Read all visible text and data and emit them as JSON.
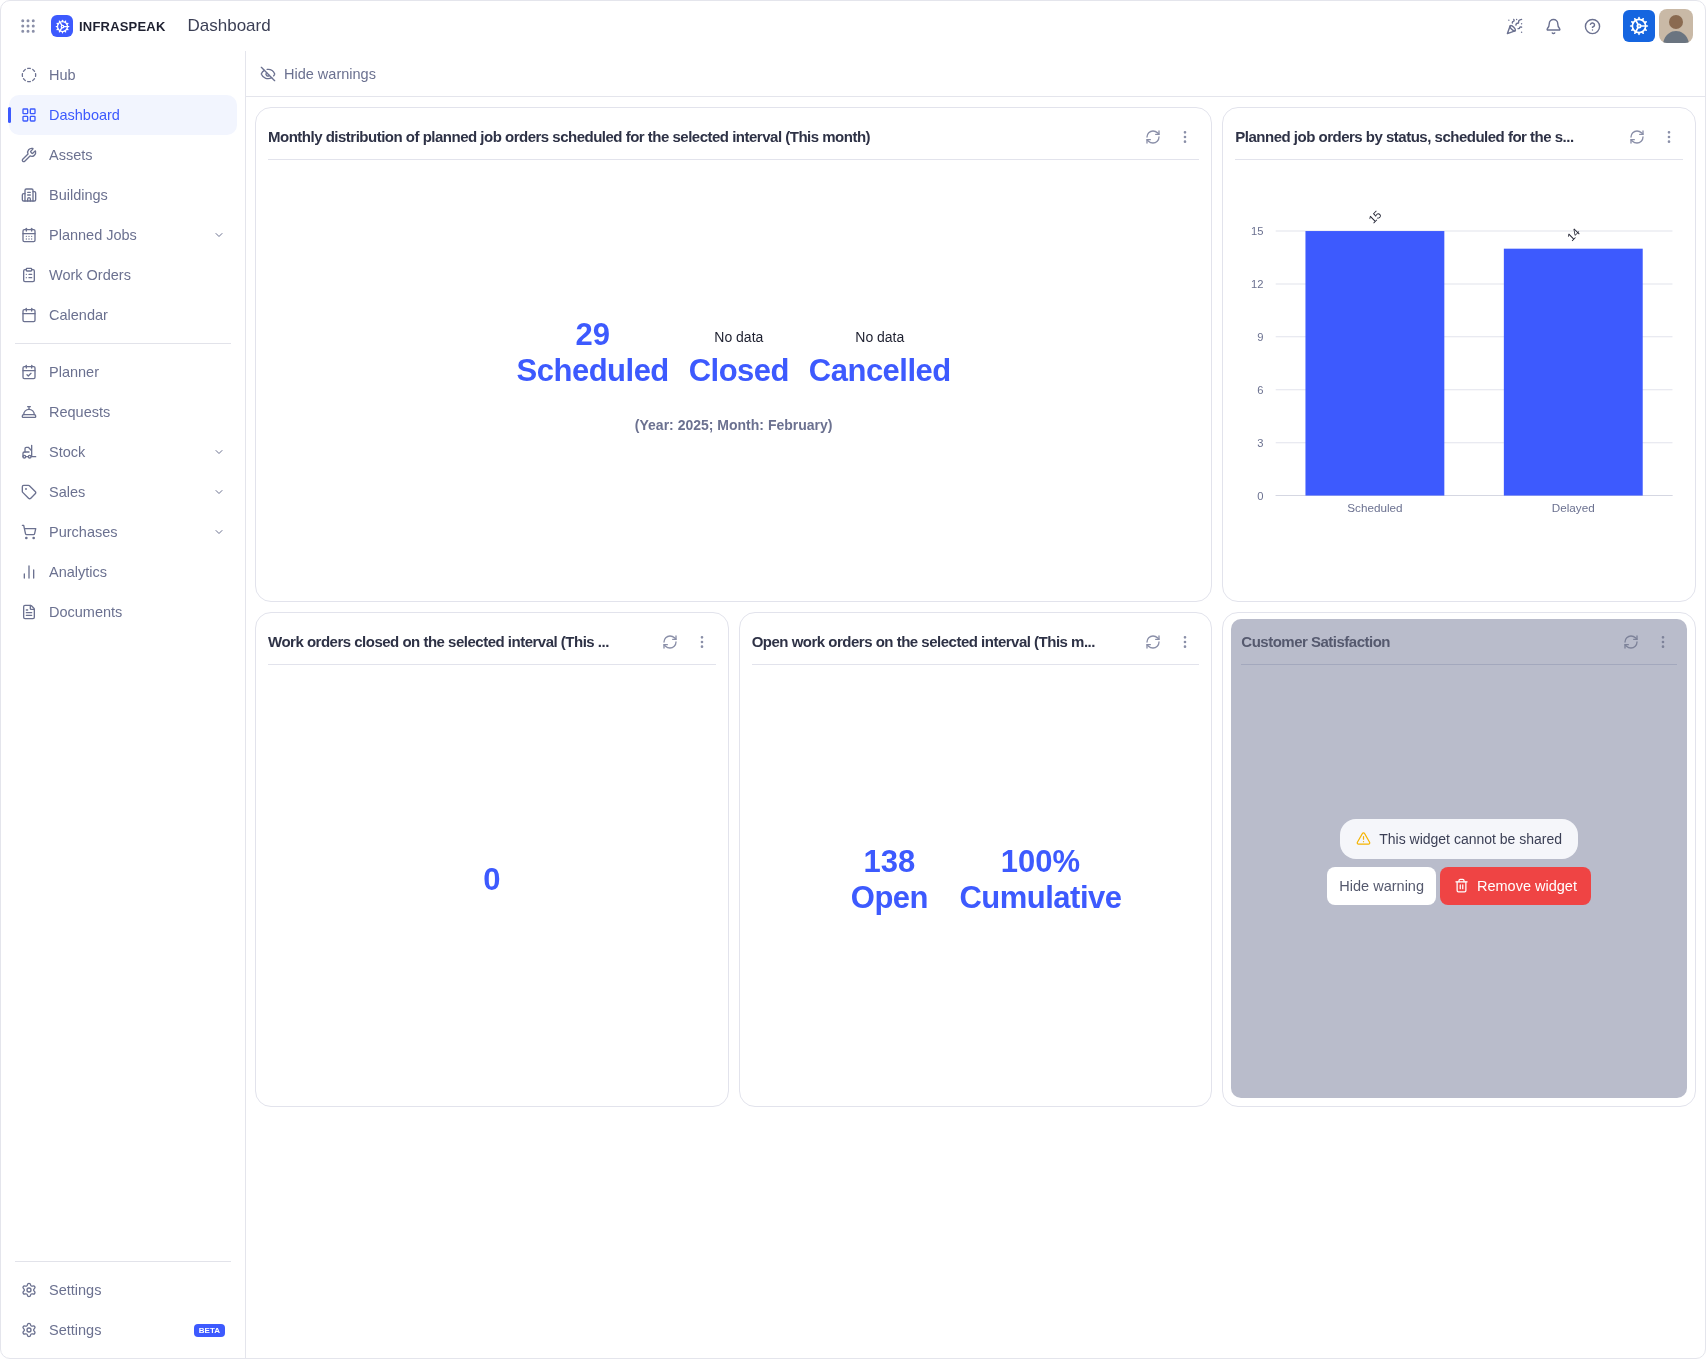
{
  "topbar": {
    "brand": "INFRASPEAK",
    "page_title": "Dashboard"
  },
  "sidebar": {
    "sections": [
      [
        {
          "label": "Hub",
          "selected": false,
          "expandable": false
        },
        {
          "label": "Dashboard",
          "selected": true,
          "expandable": false
        },
        {
          "label": "Assets",
          "selected": false,
          "expandable": false
        },
        {
          "label": "Buildings",
          "selected": false,
          "expandable": false
        },
        {
          "label": "Planned Jobs",
          "selected": false,
          "expandable": true
        },
        {
          "label": "Work Orders",
          "selected": false,
          "expandable": false
        },
        {
          "label": "Calendar",
          "selected": false,
          "expandable": false
        }
      ],
      [
        {
          "label": "Planner",
          "selected": false,
          "expandable": false
        },
        {
          "label": "Requests",
          "selected": false,
          "expandable": false
        },
        {
          "label": "Stock",
          "selected": false,
          "expandable": true
        },
        {
          "label": "Sales",
          "selected": false,
          "expandable": true
        },
        {
          "label": "Purchases",
          "selected": false,
          "expandable": true
        },
        {
          "label": "Analytics",
          "selected": false,
          "expandable": false
        },
        {
          "label": "Documents",
          "selected": false,
          "expandable": false
        }
      ]
    ],
    "footer_items": [
      {
        "label": "Settings"
      },
      {
        "label": "Settings",
        "badge": "BETA"
      }
    ]
  },
  "toolbar": {
    "hide_warnings": "Hide warnings"
  },
  "widgets": [
    {
      "kind": "stats",
      "title": "Monthly distribution of planned job orders scheduled for the selected interval (This month)",
      "stats": [
        {
          "value": "29",
          "label": "Scheduled",
          "has_data": true
        },
        {
          "value": "No data",
          "label": "Closed",
          "has_data": false
        },
        {
          "value": "No data",
          "label": "Cancelled",
          "has_data": false
        }
      ],
      "subtitle": "(Year: 2025; Month: February)"
    },
    {
      "kind": "chart",
      "title": "Planned job orders by status, scheduled for the s...",
      "chart_data": {
        "type": "bar",
        "categories": [
          "Scheduled",
          "Delayed"
        ],
        "values": [
          15,
          14
        ],
        "ylim": [
          0,
          15
        ],
        "yticks": [
          0,
          3,
          6,
          9,
          12,
          15
        ],
        "grid": true,
        "data_labels": true
      }
    },
    {
      "kind": "stats",
      "title": "Work orders closed on the selected interval (This ...",
      "stats": [
        {
          "value": "0",
          "has_data": true
        }
      ]
    },
    {
      "kind": "stats",
      "title": "Open work orders on the selected interval (This m...",
      "stats": [
        {
          "value": "138",
          "label": "Open",
          "has_data": true
        },
        {
          "value": "100%",
          "label": "Cumulative",
          "has_data": true
        }
      ]
    },
    {
      "kind": "shared_warning",
      "title": "Customer Satisfaction",
      "warning": "This widget cannot be shared",
      "hide_button": "Hide warning",
      "remove_button": "Remove widget"
    }
  ]
}
